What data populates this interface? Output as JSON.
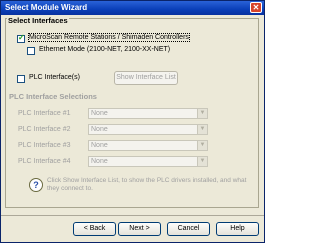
{
  "window": {
    "title": "Select Module Wizard",
    "close_glyph": "✕"
  },
  "interfaces": {
    "title": "Select Interfaces",
    "microscan": {
      "label": "MicroScan Remote Stations / Shimaden Controllers",
      "checked": true
    },
    "ethernet": {
      "label": "Ethernet Mode (2100-NET, 2100-XX-NET)",
      "checked": false
    },
    "plc": {
      "label": "PLC Interface(s)",
      "checked": false
    },
    "show_list_button": "Show Interface List"
  },
  "plc_selections": {
    "title": "PLC Interface Selections",
    "rows": [
      {
        "label": "PLC Interface #1",
        "value": "None"
      },
      {
        "label": "PLC Interface #2",
        "value": "None"
      },
      {
        "label": "PLC Interface #3",
        "value": "None"
      },
      {
        "label": "PLC Interface #4",
        "value": "None"
      }
    ]
  },
  "info": {
    "icon": "question-icon",
    "text": "Click Show Interface List, to show the PLC drivers installed, and what they connect to."
  },
  "buttons": {
    "back": "< Back",
    "next": "Next >",
    "cancel": "Cancel",
    "help": "Help"
  }
}
